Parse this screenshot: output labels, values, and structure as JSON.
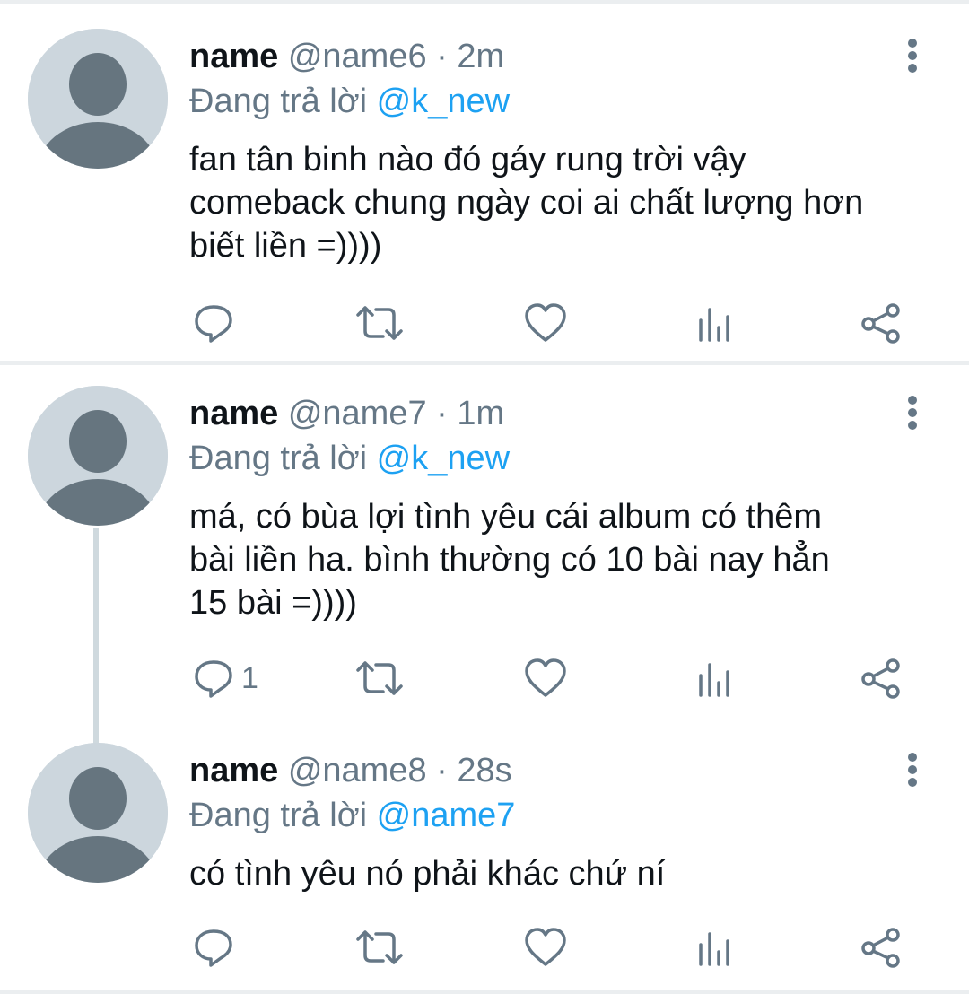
{
  "tweets": [
    {
      "name": "name",
      "handle": "@name6",
      "time": "· 2m",
      "reply_prefix": "Đang trả lời",
      "reply_to": "@k_new",
      "text_lines": [
        "fan tân binh nào đó gáy rung trời vậy",
        "comeback chung ngày coi ai chất lượng hơn",
        "biết liền =))))"
      ],
      "reply_count": ""
    },
    {
      "name": "name",
      "handle": "@name7",
      "time": "· 1m",
      "reply_prefix": "Đang trả lời",
      "reply_to": "@k_new",
      "text_lines": [
        "má, có bùa lợi tình yêu cái album có thêm",
        "bài liền ha. bình thường có 10 bài nay hẳn",
        "15 bài =))))"
      ],
      "reply_count": "1"
    },
    {
      "name": "name",
      "handle": "@name8",
      "time": "· 28s",
      "reply_prefix": "Đang trả lời",
      "reply_to": "@name7",
      "text_lines": [
        "có tình yêu nó phải khác chứ ní"
      ],
      "reply_count": ""
    }
  ],
  "icons": {
    "reply": "reply-icon",
    "retweet": "retweet-icon",
    "like": "heart-icon",
    "analytics": "analytics-icon",
    "share": "share-icon",
    "more": "more-vertical-icon",
    "avatar": "default-avatar-icon"
  },
  "colors": {
    "name": "#0f1419",
    "meta": "#657786",
    "mention": "#1da1f2",
    "divider": "#ebeef0",
    "avatar_bg": "#ccd6dd",
    "avatar_fg": "#66757f"
  }
}
